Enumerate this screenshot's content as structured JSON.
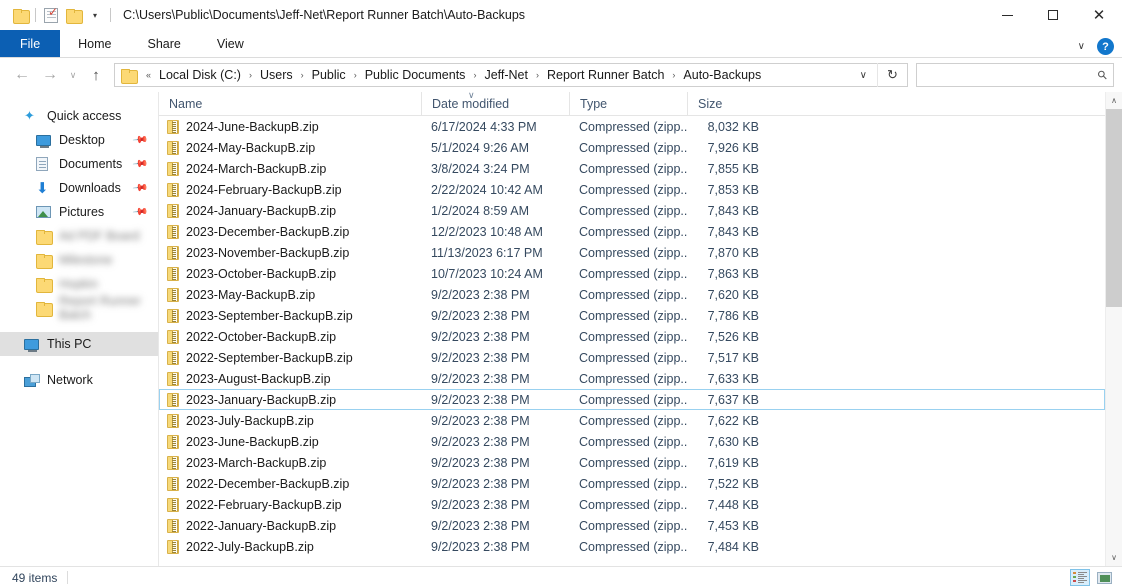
{
  "window": {
    "title_path": "C:\\Users\\Public\\Documents\\Jeff-Net\\Report Runner Batch\\Auto-Backups",
    "minimize_label": "–",
    "maximize_label": "□",
    "close_label": "✕"
  },
  "quick_access_toolbar": {
    "items": [
      {
        "icon": "folder-icon",
        "name": "explorer-icon"
      },
      {
        "icon": "properties-icon",
        "name": "properties-button"
      },
      {
        "icon": "new-folder-icon",
        "name": "new-folder-button"
      }
    ],
    "customize_caret": "▾"
  },
  "ribbon": {
    "tabs": [
      {
        "label": "File",
        "active": true
      },
      {
        "label": "Home",
        "active": false
      },
      {
        "label": "Share",
        "active": false
      },
      {
        "label": "View",
        "active": false
      }
    ],
    "expand_caret": "∨",
    "help_label": "?"
  },
  "address_bar": {
    "back": "←",
    "forward": "→",
    "recent": "∨",
    "up": "↑",
    "overflow": "«",
    "breadcrumbs": [
      "Local Disk (C:)",
      "Users",
      "Public",
      "Public Documents",
      "Jeff-Net",
      "Report Runner Batch",
      "Auto-Backups"
    ],
    "separator": "›",
    "dropdown_caret": "∨",
    "refresh": "↻",
    "search_value": "",
    "search_placeholder": "",
    "search_icon": "search-icon"
  },
  "sidebar": {
    "groups": [
      {
        "label": "Quick access",
        "icon": "star-icon",
        "items": [
          {
            "label": "Desktop",
            "icon": "monitor-icon",
            "pinned": true,
            "blurred": false
          },
          {
            "label": "Documents",
            "icon": "document-icon",
            "pinned": true,
            "blurred": false
          },
          {
            "label": "Downloads",
            "icon": "download-arrow-icon",
            "pinned": true,
            "blurred": false
          },
          {
            "label": "Pictures",
            "icon": "picture-icon",
            "pinned": true,
            "blurred": false
          },
          {
            "label": "Ad PDF Board",
            "icon": "folder-icon",
            "pinned": false,
            "blurred": true
          },
          {
            "label": "Milestone",
            "icon": "folder-icon",
            "pinned": false,
            "blurred": true
          },
          {
            "label": "Hopkin",
            "icon": "folder-icon",
            "pinned": false,
            "blurred": true
          },
          {
            "label": "Report Runner Batch",
            "icon": "folder-icon",
            "pinned": false,
            "blurred": true
          }
        ]
      }
    ],
    "this_pc": {
      "label": "This PC",
      "icon": "computer-icon",
      "selected": true
    },
    "network": {
      "label": "Network",
      "icon": "network-icon",
      "selected": false
    }
  },
  "file_list": {
    "columns": [
      {
        "label": "Name",
        "key": "name"
      },
      {
        "label": "Date modified",
        "key": "date",
        "sorted": true,
        "sort_direction": "∨"
      },
      {
        "label": "Type",
        "key": "type"
      },
      {
        "label": "Size",
        "key": "size"
      }
    ],
    "rows": [
      {
        "name": "2024-June-BackupB.zip",
        "date": "6/17/2024 4:33 PM",
        "type": "Compressed (zipp...",
        "size": "8,032 KB",
        "focused": false
      },
      {
        "name": "2024-May-BackupB.zip",
        "date": "5/1/2024 9:26 AM",
        "type": "Compressed (zipp...",
        "size": "7,926 KB",
        "focused": false
      },
      {
        "name": "2024-March-BackupB.zip",
        "date": "3/8/2024 3:24 PM",
        "type": "Compressed (zipp...",
        "size": "7,855 KB",
        "focused": false
      },
      {
        "name": "2024-February-BackupB.zip",
        "date": "2/22/2024 10:42 AM",
        "type": "Compressed (zipp...",
        "size": "7,853 KB",
        "focused": false
      },
      {
        "name": "2024-January-BackupB.zip",
        "date": "1/2/2024 8:59 AM",
        "type": "Compressed (zipp...",
        "size": "7,843 KB",
        "focused": false
      },
      {
        "name": "2023-December-BackupB.zip",
        "date": "12/2/2023 10:48 AM",
        "type": "Compressed (zipp...",
        "size": "7,843 KB",
        "focused": false
      },
      {
        "name": "2023-November-BackupB.zip",
        "date": "11/13/2023 6:17 PM",
        "type": "Compressed (zipp...",
        "size": "7,870 KB",
        "focused": false
      },
      {
        "name": "2023-October-BackupB.zip",
        "date": "10/7/2023 10:24 AM",
        "type": "Compressed (zipp...",
        "size": "7,863 KB",
        "focused": false
      },
      {
        "name": "2023-May-BackupB.zip",
        "date": "9/2/2023 2:38 PM",
        "type": "Compressed (zipp...",
        "size": "7,620 KB",
        "focused": false
      },
      {
        "name": "2023-September-BackupB.zip",
        "date": "9/2/2023 2:38 PM",
        "type": "Compressed (zipp...",
        "size": "7,786 KB",
        "focused": false
      },
      {
        "name": "2022-October-BackupB.zip",
        "date": "9/2/2023 2:38 PM",
        "type": "Compressed (zipp...",
        "size": "7,526 KB",
        "focused": false
      },
      {
        "name": "2022-September-BackupB.zip",
        "date": "9/2/2023 2:38 PM",
        "type": "Compressed (zipp...",
        "size": "7,517 KB",
        "focused": false
      },
      {
        "name": "2023-August-BackupB.zip",
        "date": "9/2/2023 2:38 PM",
        "type": "Compressed (zipp...",
        "size": "7,633 KB",
        "focused": false
      },
      {
        "name": "2023-January-BackupB.zip",
        "date": "9/2/2023 2:38 PM",
        "type": "Compressed (zipp...",
        "size": "7,637 KB",
        "focused": true
      },
      {
        "name": "2023-July-BackupB.zip",
        "date": "9/2/2023 2:38 PM",
        "type": "Compressed (zipp...",
        "size": "7,622 KB",
        "focused": false
      },
      {
        "name": "2023-June-BackupB.zip",
        "date": "9/2/2023 2:38 PM",
        "type": "Compressed (zipp...",
        "size": "7,630 KB",
        "focused": false
      },
      {
        "name": "2023-March-BackupB.zip",
        "date": "9/2/2023 2:38 PM",
        "type": "Compressed (zipp...",
        "size": "7,619 KB",
        "focused": false
      },
      {
        "name": "2022-December-BackupB.zip",
        "date": "9/2/2023 2:38 PM",
        "type": "Compressed (zipp...",
        "size": "7,522 KB",
        "focused": false
      },
      {
        "name": "2022-February-BackupB.zip",
        "date": "9/2/2023 2:38 PM",
        "type": "Compressed (zipp...",
        "size": "7,448 KB",
        "focused": false
      },
      {
        "name": "2022-January-BackupB.zip",
        "date": "9/2/2023 2:38 PM",
        "type": "Compressed (zipp...",
        "size": "7,453 KB",
        "focused": false
      },
      {
        "name": "2022-July-BackupB.zip",
        "date": "9/2/2023 2:38 PM",
        "type": "Compressed (zipp...",
        "size": "7,484 KB",
        "focused": false
      }
    ]
  },
  "scrollbar": {
    "up_arrow": "∧",
    "down_arrow": "∨",
    "thumb_percent": 45
  },
  "status_bar": {
    "item_count": "49 items",
    "views": [
      {
        "name": "details-view-button",
        "icon": "details-icon",
        "active": true
      },
      {
        "name": "large-icons-view-button",
        "icon": "large-icons-icon",
        "active": false
      }
    ]
  },
  "colors": {
    "accent": "#0c5fb3",
    "selection_outline": "#99d1f0",
    "folder_yellow": "#fcd975"
  }
}
